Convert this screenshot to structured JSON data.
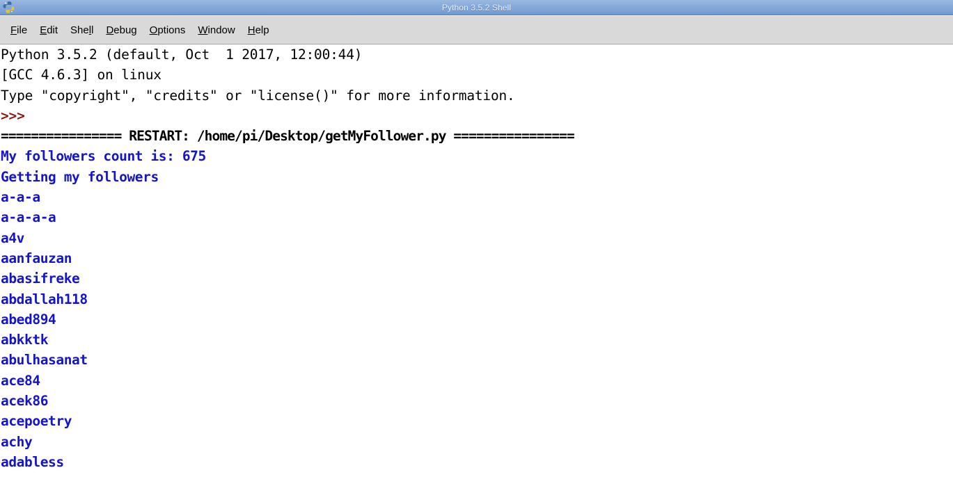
{
  "window": {
    "title": "Python 3.5.2 Shell",
    "icon": "python-logo-icon",
    "titlebar_color": "#86a9da",
    "titlebar_text_color": "#e8eef7"
  },
  "menubar": {
    "items": [
      {
        "label": "File",
        "mnemonic_index": 0
      },
      {
        "label": "Edit",
        "mnemonic_index": 0
      },
      {
        "label": "Shell",
        "mnemonic_index": 3
      },
      {
        "label": "Debug",
        "mnemonic_index": 0
      },
      {
        "label": "Options",
        "mnemonic_index": 0
      },
      {
        "label": "Window",
        "mnemonic_index": 0
      },
      {
        "label": "Help",
        "mnemonic_index": 0
      }
    ]
  },
  "shell": {
    "background_color": "#ffffff",
    "colors": {
      "banner": "#000000",
      "prompt": "#8b1a13",
      "stdout": "#1414cc"
    },
    "lines": [
      {
        "kind": "banner",
        "text": "Python 3.5.2 (default, Oct  1 2017, 12:00:44)"
      },
      {
        "kind": "banner",
        "text": "[GCC 4.6.3] on linux"
      },
      {
        "kind": "banner",
        "text": "Type \"copyright\", \"credits\" or \"license()\" for more information."
      },
      {
        "kind": "prompt",
        "text": ">>>"
      },
      {
        "kind": "restart",
        "text": "================ RESTART: /home/pi/Desktop/getMyFollower.py ================"
      },
      {
        "kind": "stdout",
        "text": "My followers count is: 675"
      },
      {
        "kind": "stdout",
        "text": "Getting my followers"
      },
      {
        "kind": "stdout",
        "text": "a-a-a"
      },
      {
        "kind": "stdout",
        "text": "a-a-a-a"
      },
      {
        "kind": "stdout",
        "text": "a4v"
      },
      {
        "kind": "stdout",
        "text": "aanfauzan"
      },
      {
        "kind": "stdout",
        "text": "abasifreke"
      },
      {
        "kind": "stdout",
        "text": "abdallah118"
      },
      {
        "kind": "stdout",
        "text": "abed894"
      },
      {
        "kind": "stdout",
        "text": "abkktk"
      },
      {
        "kind": "stdout",
        "text": "abulhasanat"
      },
      {
        "kind": "stdout",
        "text": "ace84"
      },
      {
        "kind": "stdout",
        "text": "acek86"
      },
      {
        "kind": "stdout",
        "text": "acepoetry"
      },
      {
        "kind": "stdout",
        "text": "achy"
      },
      {
        "kind": "stdout",
        "text": "adabless"
      }
    ]
  }
}
